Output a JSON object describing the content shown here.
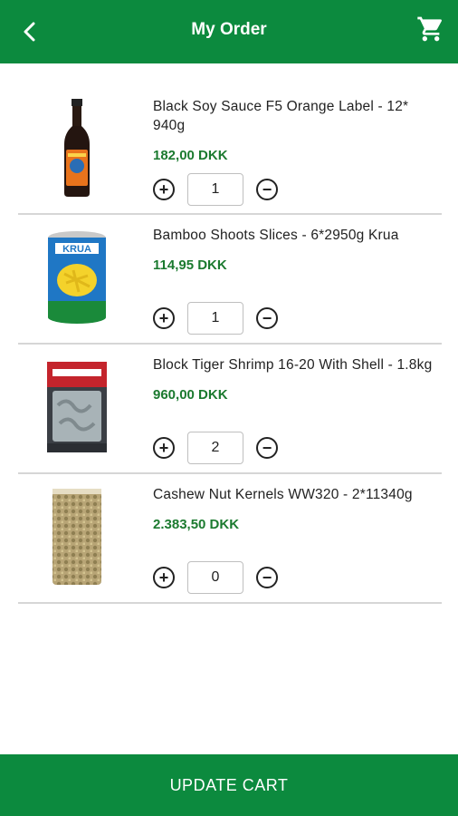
{
  "header": {
    "title": "My Order",
    "back_icon": "chevron-left-icon",
    "cart_icon": "cart-icon",
    "color": "#0c8a3e"
  },
  "items": [
    {
      "name": "Black Soy Sauce F5 Orange Label - 12* 940g",
      "price": "182,00 DKK",
      "qty": "1",
      "image": "soy-sauce-bottle"
    },
    {
      "name": "Bamboo Shoots Slices - 6*2950g Krua",
      "price": "114,95 DKK",
      "qty": "1",
      "image": "bamboo-shoots-can",
      "brand_text": "KRUA"
    },
    {
      "name": "Block Tiger Shrimp 16-20 With Shell - 1.8kg",
      "price": "960,00 DKK",
      "qty": "2",
      "image": "shrimp-bag"
    },
    {
      "name": "Cashew Nut Kernels WW320 - 2*11340g",
      "price": "2.383,50 DKK",
      "qty": "0",
      "image": "cashew-bag"
    }
  ],
  "footer": {
    "update_label": "UPDATE CART"
  }
}
